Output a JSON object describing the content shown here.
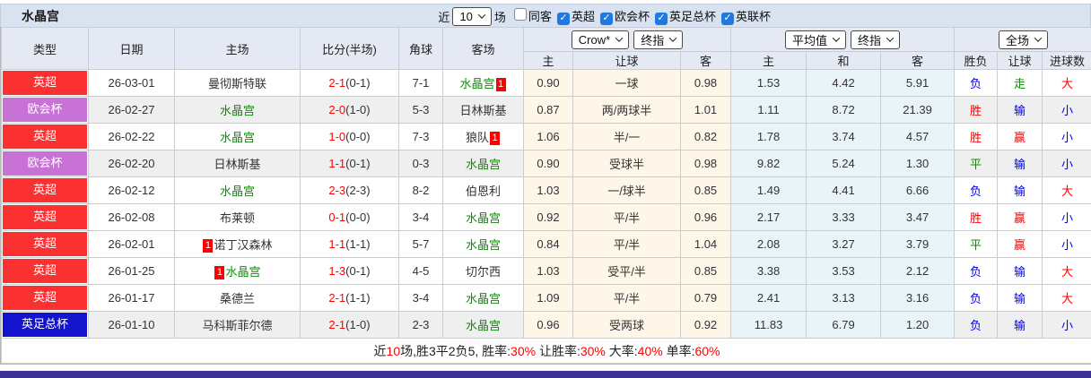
{
  "title": "水晶宫",
  "toolbar": {
    "recent_label": "近",
    "recent_value": "10",
    "matches_label": "场",
    "checkboxes": [
      {
        "label": "同客",
        "checked": false
      },
      {
        "label": "英超",
        "checked": true
      },
      {
        "label": "欧会杯",
        "checked": true
      },
      {
        "label": "英足总杯",
        "checked": true
      },
      {
        "label": "英联杯",
        "checked": true
      }
    ]
  },
  "table": {
    "main_headers": [
      "类型",
      "日期",
      "主场",
      "比分(半场)",
      "角球",
      "客场"
    ],
    "sub_headers": [
      "主",
      "让球",
      "客",
      "主",
      "和",
      "客",
      "胜负",
      "让球",
      "进球数"
    ],
    "selects": {
      "odds_company": "Crow*",
      "odds_stage1": "终指",
      "average": "平均值",
      "odds_stage2": "终指",
      "scope": "全场"
    },
    "type_colors": {
      "英超": "#fb3030",
      "欧会杯": "#c772d4",
      "英足总杯": "#1414cc"
    },
    "rows": [
      {
        "type": "英超",
        "date": "26-03-01",
        "home": {
          "name": "曼彻斯特联",
          "self": false
        },
        "score": "2-1",
        "half": "(0-1)",
        "corner": "7-1",
        "away": {
          "name": "水晶宫",
          "self": true,
          "post": "1"
        },
        "crow": [
          "0.90",
          "一球",
          "0.98"
        ],
        "avg": [
          "1.53",
          "4.42",
          "5.91"
        ],
        "res": [
          "负",
          "走",
          "大"
        ]
      },
      {
        "type": "欧会杯",
        "date": "26-02-27",
        "home": {
          "name": "水晶宫",
          "self": true
        },
        "score": "2-0",
        "half": "(1-0)",
        "corner": "5-3",
        "away": {
          "name": "日林斯基",
          "self": false
        },
        "crow": [
          "0.87",
          "两/两球半",
          "1.01"
        ],
        "avg": [
          "1.11",
          "8.72",
          "21.39"
        ],
        "res": [
          "胜",
          "输",
          "小"
        ]
      },
      {
        "type": "英超",
        "date": "26-02-22",
        "home": {
          "name": "水晶宫",
          "self": true
        },
        "score": "1-0",
        "half": "(0-0)",
        "corner": "7-3",
        "away": {
          "name": "狼队",
          "self": false,
          "post": "1"
        },
        "crow": [
          "1.06",
          "半/一",
          "0.82"
        ],
        "avg": [
          "1.78",
          "3.74",
          "4.57"
        ],
        "res": [
          "胜",
          "赢",
          "小"
        ]
      },
      {
        "type": "欧会杯",
        "date": "26-02-20",
        "home": {
          "name": "日林斯基",
          "self": false
        },
        "score": "1-1",
        "half": "(0-1)",
        "corner": "0-3",
        "away": {
          "name": "水晶宫",
          "self": true
        },
        "crow": [
          "0.90",
          "受球半",
          "0.98"
        ],
        "avg": [
          "9.82",
          "5.24",
          "1.30"
        ],
        "res": [
          "平",
          "输",
          "小"
        ]
      },
      {
        "type": "英超",
        "date": "26-02-12",
        "home": {
          "name": "水晶宫",
          "self": true
        },
        "score": "2-3",
        "half": "(2-3)",
        "corner": "8-2",
        "away": {
          "name": "伯恩利",
          "self": false
        },
        "crow": [
          "1.03",
          "一/球半",
          "0.85"
        ],
        "avg": [
          "1.49",
          "4.41",
          "6.66"
        ],
        "res": [
          "负",
          "输",
          "大"
        ]
      },
      {
        "type": "英超",
        "date": "26-02-08",
        "home": {
          "name": "布莱顿",
          "self": false
        },
        "score": "0-1",
        "half": "(0-0)",
        "corner": "3-4",
        "away": {
          "name": "水晶宫",
          "self": true
        },
        "crow": [
          "0.92",
          "平/半",
          "0.96"
        ],
        "avg": [
          "2.17",
          "3.33",
          "3.47"
        ],
        "res": [
          "胜",
          "赢",
          "小"
        ]
      },
      {
        "type": "英超",
        "date": "26-02-01",
        "home": {
          "name": "诺丁汉森林",
          "self": false,
          "pre": "1"
        },
        "score": "1-1",
        "half": "(1-1)",
        "corner": "5-7",
        "away": {
          "name": "水晶宫",
          "self": true
        },
        "crow": [
          "0.84",
          "平/半",
          "1.04"
        ],
        "avg": [
          "2.08",
          "3.27",
          "3.79"
        ],
        "res": [
          "平",
          "赢",
          "小"
        ]
      },
      {
        "type": "英超",
        "date": "26-01-25",
        "home": {
          "name": "水晶宫",
          "self": true,
          "pre": "1"
        },
        "score": "1-3",
        "half": "(0-1)",
        "corner": "4-5",
        "away": {
          "name": "切尔西",
          "self": false
        },
        "crow": [
          "1.03",
          "受平/半",
          "0.85"
        ],
        "avg": [
          "3.38",
          "3.53",
          "2.12"
        ],
        "res": [
          "负",
          "输",
          "大"
        ]
      },
      {
        "type": "英超",
        "date": "26-01-17",
        "home": {
          "name": "桑德兰",
          "self": false
        },
        "score": "2-1",
        "half": "(1-1)",
        "corner": "3-4",
        "away": {
          "name": "水晶宫",
          "self": true
        },
        "crow": [
          "1.09",
          "平/半",
          "0.79"
        ],
        "avg": [
          "2.41",
          "3.13",
          "3.16"
        ],
        "res": [
          "负",
          "输",
          "大"
        ]
      },
      {
        "type": "英足总杯",
        "date": "26-01-10",
        "home": {
          "name": "马科斯菲尔德",
          "self": false
        },
        "score": "2-1",
        "half": "(1-0)",
        "corner": "2-3",
        "away": {
          "name": "水晶宫",
          "self": true
        },
        "crow": [
          "0.96",
          "受两球",
          "0.92"
        ],
        "avg": [
          "11.83",
          "6.79",
          "1.20"
        ],
        "res": [
          "负",
          "输",
          "小"
        ]
      }
    ]
  },
  "summary_segments": [
    {
      "text": "近",
      "red": false
    },
    {
      "text": "10",
      "red": true
    },
    {
      "text": "场,胜3平2负5, 胜率:",
      "red": false
    },
    {
      "text": "30%",
      "red": true
    },
    {
      "text": " 让胜率:",
      "red": false
    },
    {
      "text": "30%",
      "red": true
    },
    {
      "text": " 大率:",
      "red": false
    },
    {
      "text": "40%",
      "red": true
    },
    {
      "text": " 单率:",
      "red": false
    },
    {
      "text": "60%",
      "red": true
    }
  ]
}
